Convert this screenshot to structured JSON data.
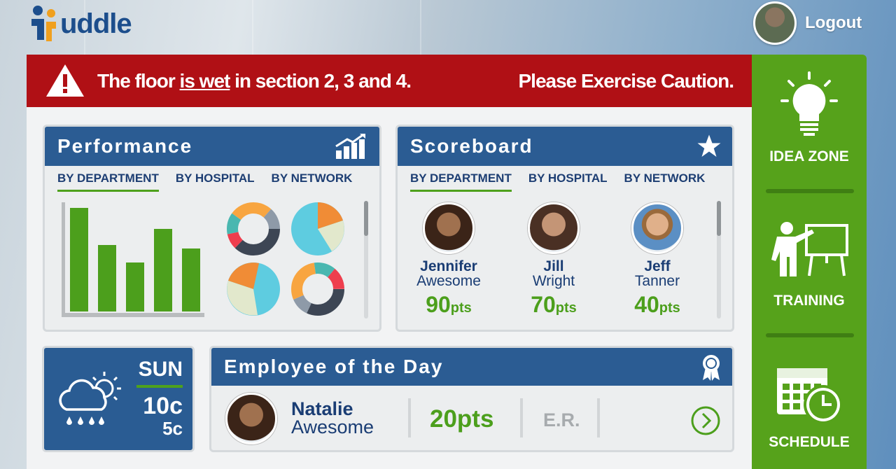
{
  "app": {
    "logo_text": "uddle"
  },
  "header": {
    "logout_label": "Logout"
  },
  "alert": {
    "text_before": "The floor ",
    "text_underlined": "is wet",
    "text_after": " in section 2, 3 and 4.",
    "caution": "Please Exercise Caution."
  },
  "performance": {
    "title": "Performance",
    "tabs": [
      "BY DEPARTMENT",
      "BY HOSPITAL",
      "BY NETWORK"
    ],
    "active_tab": "BY DEPARTMENT",
    "chart_data": {
      "type": "bar",
      "values": [
        148,
        95,
        70,
        118,
        90
      ]
    }
  },
  "scoreboard": {
    "title": "Scoreboard",
    "tabs": [
      "BY DEPARTMENT",
      "BY HOSPITAL",
      "BY NETWORK"
    ],
    "active_tab": "BY DEPARTMENT",
    "people": [
      {
        "first": "Jennifer",
        "last": "Awesome",
        "points": "90",
        "unit": "pts"
      },
      {
        "first": "Jill",
        "last": "Wright",
        "points": "70",
        "unit": "pts"
      },
      {
        "first": "Jeff",
        "last": "Tanner",
        "points": "40",
        "unit": "pts"
      }
    ]
  },
  "weather": {
    "day": "SUN",
    "high": "10c",
    "low": "5c"
  },
  "employee_of_day": {
    "title": "Employee of the Day",
    "first": "Natalie",
    "last": "Awesome",
    "points": "20pts",
    "department": "E.R."
  },
  "sidebar": {
    "items": [
      {
        "label": "IDEA ZONE"
      },
      {
        "label": "TRAINING"
      },
      {
        "label": "SCHEDULE"
      }
    ]
  },
  "colors": {
    "alert_red": "#b01015",
    "brand_blue": "#2b5c93",
    "accent_green": "#56a21b"
  }
}
